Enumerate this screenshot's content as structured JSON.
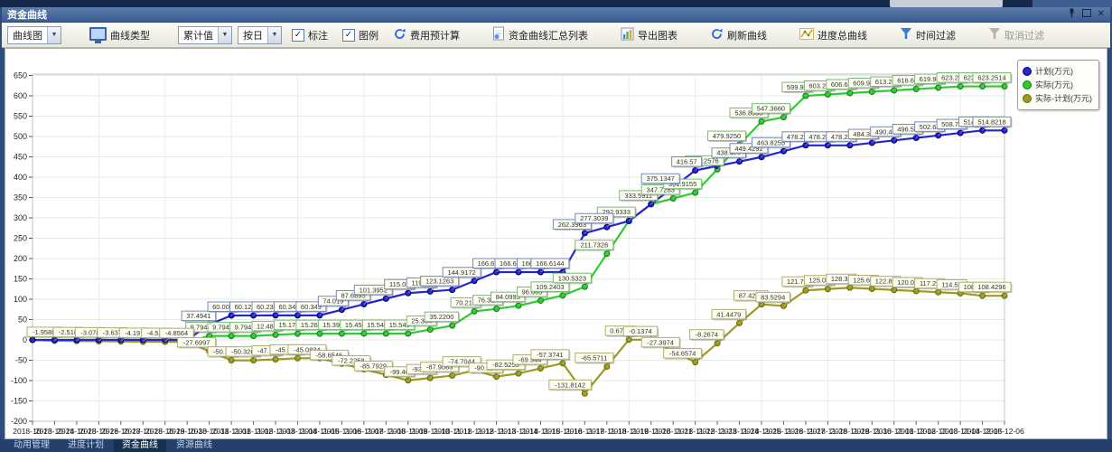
{
  "window": {
    "title": "资金曲线"
  },
  "window_controls": {
    "pin": "pin",
    "maximize": "maximize",
    "close": "✕"
  },
  "toolbar": {
    "curve_chart": "曲线图",
    "curve_type": "曲线类型",
    "cumulative": "累计值",
    "by_day": "按日",
    "annotate": "标注",
    "annotate_checked": true,
    "legend": "图例",
    "legend_checked": true,
    "precalc": "费用预计算",
    "summary_list": "资金曲线汇总列表",
    "export_chart": "导出图表",
    "refresh_curve": "刷新曲线",
    "progress_curve": "进度总曲线",
    "time_filter": "时间过滤",
    "cancel_filter": "取消过滤"
  },
  "bottom_tabs": {
    "items": [
      "动用管理",
      "进度计划",
      "资金曲线",
      "资源曲线"
    ],
    "active_index": 2
  },
  "chart_data": {
    "type": "line",
    "title": "",
    "grid": true,
    "legend_position": "top-right",
    "ylim": [
      -200,
      655
    ],
    "yticks": [
      -200,
      -150,
      -100,
      -50,
      0,
      50,
      100,
      150,
      200,
      250,
      300,
      350,
      400,
      450,
      500,
      550,
      600,
      650
    ],
    "x": [
      "2018-10-23",
      "2018-10-24",
      "2018-10-25",
      "2018-10-26",
      "2018-10-27",
      "2018-10-28",
      "2018-10-29",
      "2018-10-30",
      "2018-10-31",
      "2018-11-01",
      "2018-11-02",
      "2018-11-03",
      "2018-11-04",
      "2018-11-05",
      "2018-11-06",
      "2018-11-07",
      "2018-11-08",
      "2018-11-09",
      "2018-11-10",
      "2018-11-11",
      "2018-11-12",
      "2018-11-13",
      "2018-11-14",
      "2018-11-15",
      "2018-11-16",
      "2018-11-17",
      "2018-11-18",
      "2018-11-19",
      "2018-11-20",
      "2018-11-21",
      "2018-11-22",
      "2018-11-23",
      "2018-11-24",
      "2018-11-25",
      "2018-11-26",
      "2018-11-27",
      "2018-11-28",
      "2018-11-29",
      "2018-11-30",
      "2018-12-01",
      "2018-12-02",
      "2018-12-03",
      "2018-12-04",
      "2018-12-05",
      "2018-12-06"
    ],
    "series": [
      {
        "name": "计划(万元)",
        "color": "#2626cc",
        "ring": "#000080",
        "box_border": "#7788bb",
        "values": [
          0,
          0,
          0,
          0,
          0,
          0,
          0,
          0,
          37.4941,
          60.007,
          60.121,
          60.234,
          60.348,
          60.349,
          74.019,
          87.6895,
          101.3952,
          115.01,
          119.06,
          123.1263,
          144.9172,
          166.61,
          166.61,
          166.61,
          166.6144,
          262.3963,
          277.3039,
          292.2613,
          333.7285,
          375.1347,
          416.57,
          427.525,
          438.477,
          449.4292,
          463.8255,
          478.24,
          478.24,
          478.24,
          484.34,
          490.43,
          496.53,
          502.62,
          508.72,
          514.82,
          514.8218
        ],
        "labels": [
          null,
          null,
          null,
          null,
          null,
          null,
          null,
          null,
          "37.4941",
          "60.007",
          "60.121",
          "60.234",
          "60.348",
          "60.349",
          "74.019",
          "87.6895",
          "101.3952",
          "115.01",
          "119.06",
          "123.1263",
          "144.9172",
          "166.61",
          "166.61",
          "166.61",
          "166.6144",
          "262.3963",
          "277.3039",
          null,
          null,
          "375.1347",
          "416.57",
          null,
          "438.477",
          "449.4292",
          "463.8255",
          "478.24",
          "478.24",
          "478.24",
          "484.34",
          "490.43",
          "496.53",
          "502.62",
          "508.72",
          "514.82",
          "514.8218"
        ]
      },
      {
        "name": "实际(万元)",
        "color": "#2ecc2e",
        "ring": "#1a7a1a",
        "box_border": "#77bb77",
        "values": [
          0,
          -1.9588,
          -2.518,
          -3.078,
          -3.637,
          -4.197,
          -4.526,
          -4.8564,
          9.7944,
          9.7944,
          9.7944,
          12.482,
          15.17,
          15.265,
          15.399,
          15.454,
          15.549,
          15.549,
          25.384,
          35.22,
          70.212,
          76.317,
          84.0993,
          96.665,
          109.2403,
          130.5323,
          211.7328,
          292.9333,
          333.5911,
          347.7283,
          361.9155,
          419.2576,
          479.925,
          536.8955,
          547.366,
          599.97,
          603.29,
          606.62,
          609.95,
          613.27,
          616.6,
          619.92,
          623.25,
          623.25,
          623.2514
        ],
        "labels": [
          null,
          null,
          null,
          null,
          null,
          null,
          null,
          null,
          "9.7944",
          "9.7944",
          "9.7944",
          "12.482",
          "15.170",
          "15.265",
          "15.399",
          "15.454",
          "15.549",
          "15.549",
          "25.384",
          "35.2200",
          "70.212",
          "76.317",
          "84.0993",
          "96.665",
          "109.2403",
          "130.5323",
          "211.7328",
          "292.9333",
          "333.5911",
          "347.7283",
          "361.9155",
          "419.2576",
          "479.9250",
          "536.8955",
          "547.3660",
          "599.97",
          "603.29",
          "606.62",
          "609.95",
          "613.27",
          "616.60",
          "619.92",
          "623.25",
          "623.25",
          "623.2514"
        ]
      },
      {
        "name": "实际-计划(万元)",
        "color": "#9c9c20",
        "ring": "#6b6b00",
        "box_border": "#b0ae70",
        "values": [
          0,
          -1.9588,
          -2.518,
          -3.078,
          -3.637,
          -4.197,
          -4.526,
          -4.8564,
          -27.6997,
          -50.21,
          -50.326,
          -47.75,
          -45.178,
          -45.0834,
          -58.6546,
          -72.2258,
          -85.7929,
          -99.46,
          -93.68,
          -87.9083,
          -74.7044,
          -90.294,
          -82.5255,
          -69.944,
          -57.3741,
          -131.8142,
          -65.5711,
          0.672,
          -0.1374,
          -27.3974,
          -54.6574,
          -8.2674,
          41.4479,
          87.4238,
          83.5294,
          121.73,
          125.05,
          128.38,
          125.6,
          122.83,
          120.06,
          117.29,
          114.52,
          108.42,
          108.4296
        ],
        "labels": [
          null,
          "-1.9588",
          "-2.518",
          "-3.078",
          "-3.637",
          "-4.197",
          "-4.526",
          "-4.8564",
          "-27.6997",
          "-50.21",
          "-50.326",
          "-47.75",
          "-45.178",
          "-45.0834",
          "-58.6546",
          "-72.2258",
          "-85.7929",
          "-99.46",
          "-93.68",
          "-87.9083",
          "-74.7044",
          "-90.294",
          "-82.5255",
          "-69.944",
          "-57.3741",
          "-131.8142",
          "-65.5711",
          "0.6720",
          "-0.1374",
          "-27.3974",
          "-54.6574",
          "-8.2674",
          "41.4479",
          "87.4238",
          "83.5294",
          "121.73",
          "125.05",
          "128.38",
          "125.60",
          "122.83",
          "120.06",
          "117.29",
          "114.52",
          "108.42",
          "108.4296"
        ]
      }
    ]
  }
}
